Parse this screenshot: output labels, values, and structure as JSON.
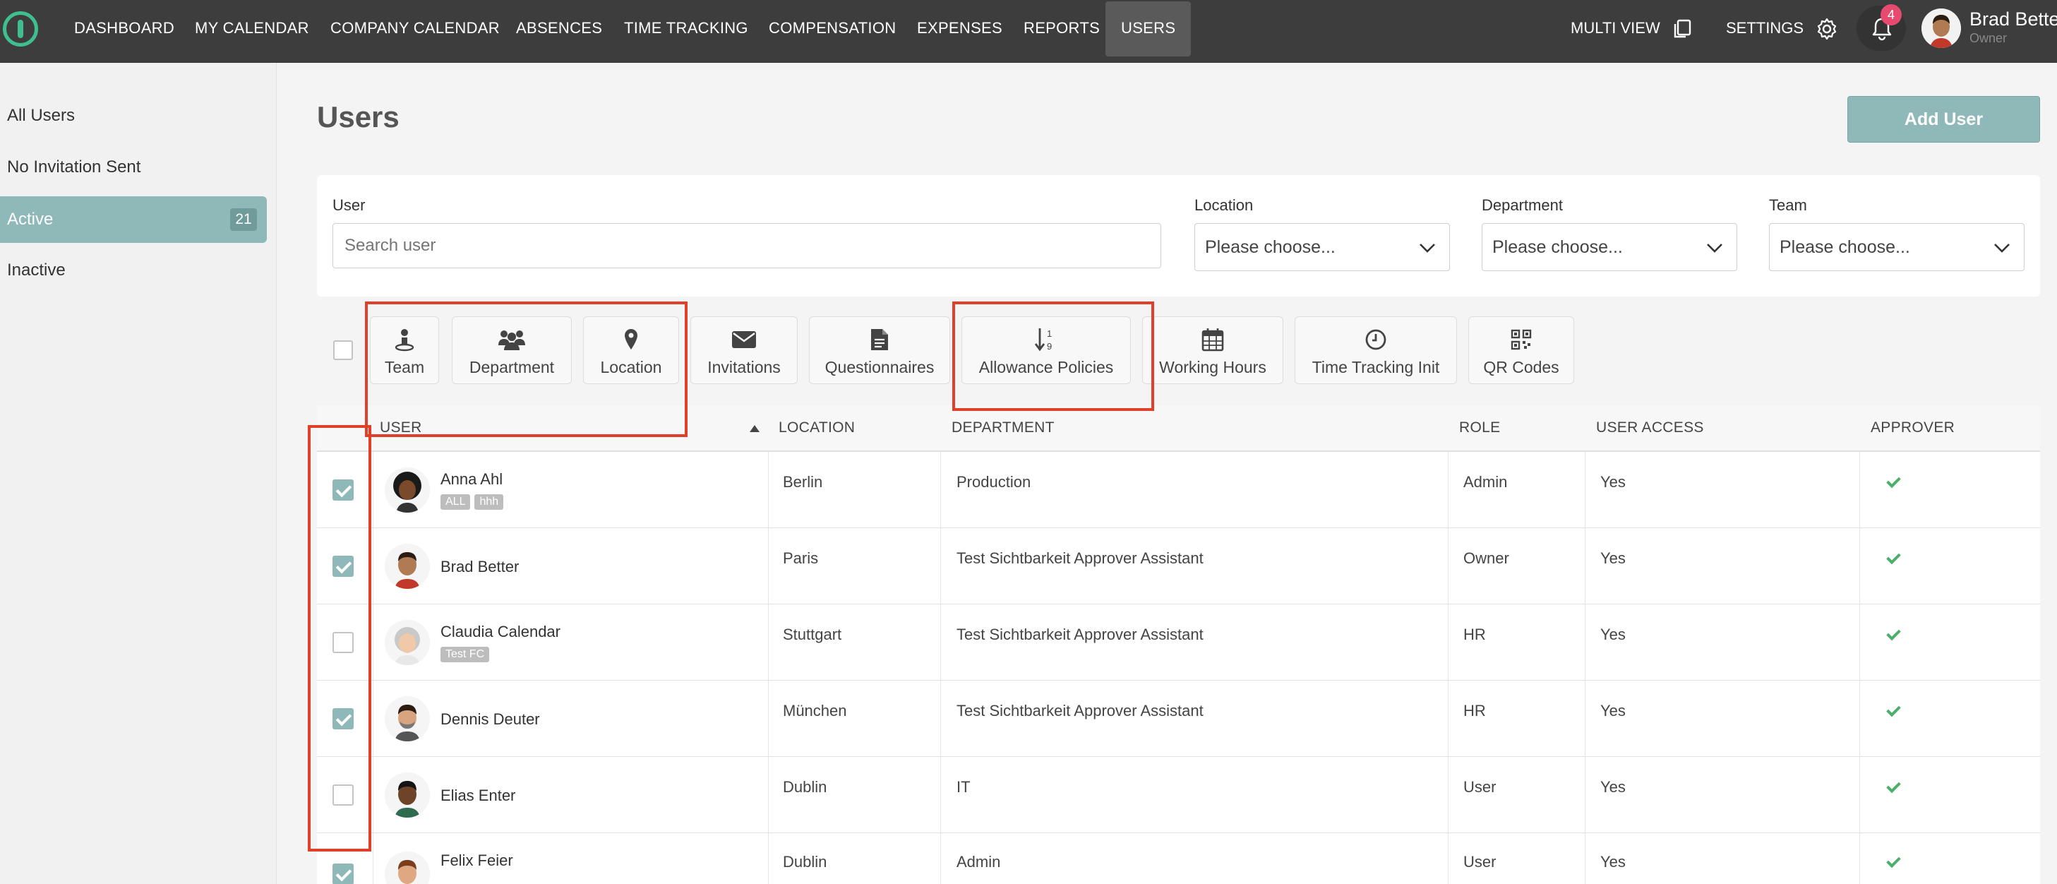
{
  "nav": {
    "items": [
      "DASHBOARD",
      "MY CALENDAR",
      "COMPANY CALENDAR",
      "ABSENCES",
      "TIME TRACKING",
      "COMPENSATION",
      "EXPENSES",
      "REPORTS",
      "USERS"
    ],
    "active": "USERS",
    "multi_view": "MULTI VIEW",
    "settings": "SETTINGS",
    "notification_count": "4",
    "user_name": "Brad Better",
    "user_role": "Owner"
  },
  "sidebar": {
    "items": [
      {
        "label": "All Users"
      },
      {
        "label": "No Invitation Sent"
      },
      {
        "label": "Active",
        "count": "21"
      },
      {
        "label": "Inactive"
      }
    ]
  },
  "page": {
    "title": "Users",
    "add_button": "Add User"
  },
  "filters": {
    "user_label": "User",
    "user_placeholder": "Search user",
    "location_label": "Location",
    "department_label": "Department",
    "team_label": "Team",
    "select_placeholder": "Please choose..."
  },
  "toolbar": {
    "buttons": [
      "Team",
      "Department",
      "Location",
      "Invitations",
      "Questionnaires",
      "Allowance Policies",
      "Working Hours",
      "Time Tracking Init",
      "QR Codes"
    ]
  },
  "table": {
    "columns": [
      "USER",
      "LOCATION",
      "DEPARTMENT",
      "ROLE",
      "USER ACCESS",
      "APPROVER"
    ],
    "rows": [
      {
        "name": "Anna Ahl",
        "tags": [
          "ALL",
          "hhh"
        ],
        "location": "Berlin",
        "department": "Production",
        "role": "Admin",
        "access": "Yes",
        "checked": true
      },
      {
        "name": "Brad Better",
        "tags": [],
        "location": "Paris",
        "department": "Test Sichtbarkeit Approver Assistant",
        "role": "Owner",
        "access": "Yes",
        "checked": true
      },
      {
        "name": "Claudia Calendar",
        "tags": [
          "Test FC"
        ],
        "location": "Stuttgart",
        "department": "Test Sichtbarkeit Approver Assistant",
        "role": "HR",
        "access": "Yes",
        "checked": false
      },
      {
        "name": "Dennis Deuter",
        "tags": [],
        "location": "München",
        "department": "Test Sichtbarkeit Approver Assistant",
        "role": "HR",
        "access": "Yes",
        "checked": true
      },
      {
        "name": "Elias Enter",
        "tags": [],
        "location": "Dublin",
        "department": "IT",
        "role": "User",
        "access": "Yes",
        "checked": false
      },
      {
        "name": "Felix Feier",
        "tags": [],
        "location": "Dublin",
        "department": "Admin",
        "role": "User",
        "access": "Yes",
        "checked": true
      }
    ]
  },
  "colors": {
    "nav_bg": "#3d3d3d",
    "accent": "#8fb8b8",
    "highlight": "#e0402a",
    "approver_check": "#4caf6d"
  }
}
